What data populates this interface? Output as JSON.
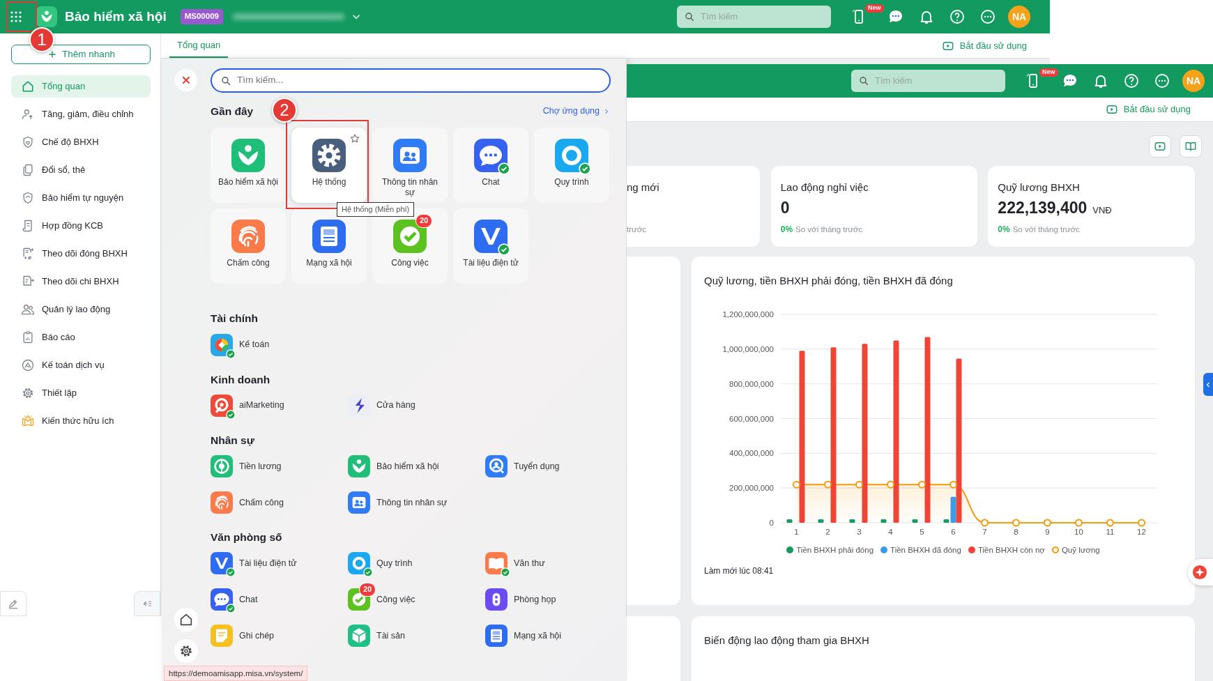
{
  "app_bar": {
    "title": "Bảo hiểm xã hội",
    "company_code": "MS00009",
    "search": {
      "placeholder": "Tìm kiếm"
    },
    "new_badge": "New",
    "avatar": "NA"
  },
  "sidebar": {
    "quick_add": "Thêm nhanh",
    "items": [
      {
        "label": "Tổng quan",
        "selected": true
      },
      {
        "label": "Tăng, giảm, điều chỉnh",
        "selected": false
      },
      {
        "label": "Chế độ BHXH",
        "selected": false
      },
      {
        "label": "Đổi sổ, thẻ",
        "selected": false
      },
      {
        "label": "Bảo hiểm tự nguyện",
        "selected": false
      },
      {
        "label": "Hợp đồng KCB",
        "selected": false
      },
      {
        "label": "Theo dõi đóng BHXH",
        "selected": false
      },
      {
        "label": "Theo dõi chi BHXH",
        "selected": false
      },
      {
        "label": "Quản lý lao động",
        "selected": false
      },
      {
        "label": "Báo cáo",
        "selected": false
      },
      {
        "label": "Kế toán dịch vụ",
        "selected": false
      },
      {
        "label": "Thiết lập",
        "selected": false
      },
      {
        "label": "Kiến thức hữu ích",
        "selected": false
      }
    ]
  },
  "tabs": [
    {
      "label": "Tổng quan",
      "selected": true
    }
  ],
  "start_link": "Bắt đầu sử dụng",
  "launcher": {
    "search": {
      "placeholder": "Tìm kiếm..."
    },
    "recent": {
      "title": "Gần đây",
      "store_link": "Chợ ứng dụng",
      "apps": [
        {
          "label": "Bảo hiểm xã hội",
          "kind": "insurance",
          "color": "#1fbf7a",
          "verified": false,
          "hovered": false
        },
        {
          "label": "Hệ thống",
          "kind": "gear",
          "color": "#4a5f7e",
          "verified": false,
          "hovered": true
        },
        {
          "label": "Thông tin nhân sự",
          "kind": "people",
          "color": "#2f7cf6",
          "verified": false,
          "hovered": false
        },
        {
          "label": "Chat",
          "kind": "chat",
          "color": "#3563f0",
          "verified": true,
          "hovered": false
        },
        {
          "label": "Quy trình",
          "kind": "flow",
          "color": "#1aa8f0",
          "verified": true,
          "hovered": false
        },
        {
          "label": "Chấm công",
          "kind": "fingerprint",
          "color": "#f97b4a",
          "verified": false,
          "hovered": false
        },
        {
          "label": "Mạng xã hội",
          "kind": "news",
          "color": "#2f6df0",
          "verified": false,
          "hovered": false
        },
        {
          "label": "Công việc",
          "kind": "task",
          "color": "#5cc21f",
          "verified": false,
          "hovered": false,
          "badge": "20"
        },
        {
          "label": "Tài liệu điện tử",
          "kind": "document",
          "color": "#2e6cf2",
          "verified": true,
          "hovered": false
        }
      ]
    },
    "tooltip": "Hệ thống (Miễn phí)",
    "sections": [
      {
        "title": "Tài chính",
        "apps": [
          {
            "label": "Kế toán",
            "kind": "accounting",
            "color": "#29a8e8",
            "verified": true
          }
        ]
      },
      {
        "title": "Kinh doanh",
        "apps": [
          {
            "label": "aiMarketing",
            "kind": "marketing",
            "color": "#ef4b3a",
            "verified": true
          },
          {
            "label": "Cửa hàng",
            "kind": "store",
            "color": "#eceef6",
            "verified": false
          }
        ]
      },
      {
        "title": "Nhân sự",
        "apps": [
          {
            "label": "Tiền lương",
            "kind": "money",
            "color": "#1fbf7a",
            "verified": false
          },
          {
            "label": "Bảo hiểm xã hội",
            "kind": "insurance",
            "color": "#1fbf7a",
            "verified": false
          },
          {
            "label": "Tuyển dụng",
            "kind": "recruit",
            "color": "#2f7cf6",
            "verified": false
          },
          {
            "label": "Chấm công",
            "kind": "fingerprint",
            "color": "#f97b4a",
            "verified": false
          },
          {
            "label": "Thông tin nhân sự",
            "kind": "people",
            "color": "#2f7cf6",
            "verified": false
          }
        ]
      },
      {
        "title": "Văn phòng số",
        "apps": [
          {
            "label": "Tài liệu điện tử",
            "kind": "document",
            "color": "#2e6cf2",
            "verified": true
          },
          {
            "label": "Quy trình",
            "kind": "flow",
            "color": "#1aa8f0",
            "verified": true
          },
          {
            "label": "Văn thư",
            "kind": "book",
            "color": "#f97b4a",
            "verified": true
          },
          {
            "label": "Chat",
            "kind": "chat",
            "color": "#3563f0",
            "verified": true
          },
          {
            "label": "Công việc",
            "kind": "task",
            "color": "#5cc21f",
            "verified": false,
            "badge": "20"
          },
          {
            "label": "Phòng họp",
            "kind": "meeting",
            "color": "#6a4cf0",
            "verified": false
          },
          {
            "label": "Ghi chép",
            "kind": "note",
            "color": "#f7c021",
            "verified": false
          },
          {
            "label": "Tài sản",
            "kind": "box",
            "color": "#1fbf85",
            "verified": false
          },
          {
            "label": "Mạng xã hội",
            "kind": "news",
            "color": "#2f6df0",
            "verified": false
          }
        ]
      }
    ]
  },
  "status_url": "https://demoamisapp.misa.vn/system/",
  "dashboard": {
    "app_bar": {
      "search": {
        "placeholder": "Tìm kiếm"
      },
      "new_badge": "New",
      "avatar": "NA"
    },
    "start_link": "Bắt đầu sử dụng",
    "stats": [
      {
        "label": "ng mới",
        "note": "trước"
      },
      {
        "label": "Lao động nghỉ việc",
        "value": "0",
        "change": "0%",
        "note": "So với tháng trước"
      },
      {
        "label": "Quỹ lương BHXH",
        "value": "222,139,400",
        "unit": "VNĐ",
        "change": "0%",
        "note": "So với tháng trước"
      }
    ],
    "chart_card": {
      "title": "Quỹ lương, tiền BHXH phải đóng, tiền BHXH đã đóng",
      "refreshed": "Làm mới lúc 08:41",
      "chart_data": {
        "type": "bar",
        "categories": [
          "1",
          "2",
          "3",
          "4",
          "5",
          "6",
          "7",
          "8",
          "9",
          "10",
          "11",
          "12"
        ],
        "ylim": [
          0,
          1200000000
        ],
        "grid": true,
        "yticks": [
          {
            "value": 0,
            "label": "0"
          },
          {
            "value": 200000000,
            "label": "200,000,000"
          },
          {
            "value": 400000000,
            "label": "400,000,000"
          },
          {
            "value": 600000000,
            "label": "600,000,000"
          },
          {
            "value": 800000000,
            "label": "800,000,000"
          },
          {
            "value": 1000000000,
            "label": "1,000,000,000"
          },
          {
            "value": 1200000000,
            "label": "1,200,000,000"
          }
        ],
        "series": [
          {
            "name": "Tiền BHXH phải đóng",
            "type": "bar",
            "color": "#169c5f",
            "values": [
              20000000,
              20000000,
              20000000,
              20000000,
              20000000,
              20000000,
              null,
              null,
              null,
              null,
              null,
              null
            ]
          },
          {
            "name": "Tiền BHXH đã đóng",
            "type": "bar",
            "color": "#3d9be9",
            "values": [
              null,
              null,
              null,
              null,
              null,
              150000000,
              null,
              null,
              null,
              null,
              null,
              null
            ]
          },
          {
            "name": "Tiền BHXH còn nợ",
            "type": "bar",
            "color": "#ef4537",
            "values": [
              990000000,
              1010000000,
              1030000000,
              1050000000,
              1070000000,
              945000000,
              null,
              null,
              null,
              null,
              null,
              null
            ]
          },
          {
            "name": "Quỹ lương",
            "type": "line",
            "marker": true,
            "color": "#f59a0b",
            "values": [
              220000000,
              220000000,
              220000000,
              220000000,
              220000000,
              220000000,
              0,
              0,
              0,
              0,
              0,
              0
            ]
          }
        ]
      }
    },
    "bottom_card": {
      "title": "Biến động lao động tham gia BHXH"
    }
  },
  "annotations": [
    {
      "label": "1"
    },
    {
      "label": "2"
    }
  ]
}
